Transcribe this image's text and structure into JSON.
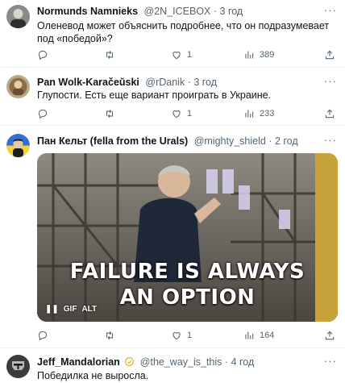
{
  "tweets": [
    {
      "name": "Normunds Namnieks",
      "handle": "@2N_ICEBOX",
      "time": "3 год",
      "text": "Оленевод может объяснить подробнее, что он подразумевает под «победой»?",
      "replies": "",
      "retweets": "",
      "likes": "1",
      "views": "389"
    },
    {
      "name": "Pan Wolk-Karačeŭski",
      "handle": "@rDanik",
      "time": "3 год",
      "text": "Глупости. Есть еще вариант проиграть в Украине.",
      "replies": "",
      "retweets": "",
      "likes": "1",
      "views": "233"
    },
    {
      "name": "Пан Кельт (fella from the Urals)",
      "handle": "@mighty_shield",
      "time": "2 год",
      "text": "",
      "media": {
        "caption_line1": "FAILURE IS ALWAYS",
        "caption_line2": "AN OPTION",
        "gif_label": "GIF",
        "alt_label": "ALT"
      },
      "replies": "",
      "retweets": "",
      "likes": "1",
      "views": "164"
    },
    {
      "name": "Jeff_Mandalorian",
      "handle": "@the_way_is_this",
      "time": "4 год",
      "text": "Победилка не выросла."
    }
  ],
  "dot": "·",
  "more": "···",
  "icons": {
    "reply": "reply-icon",
    "retweet": "retweet-icon",
    "like": "heart-icon",
    "views": "views-icon",
    "share": "share-icon",
    "more": "more-icon",
    "verified": "verified-badge-icon"
  },
  "colors": {
    "text_primary": "#0f1419",
    "text_secondary": "#536471",
    "divider": "#eff3f4",
    "verified_gold": "#e2b719"
  }
}
